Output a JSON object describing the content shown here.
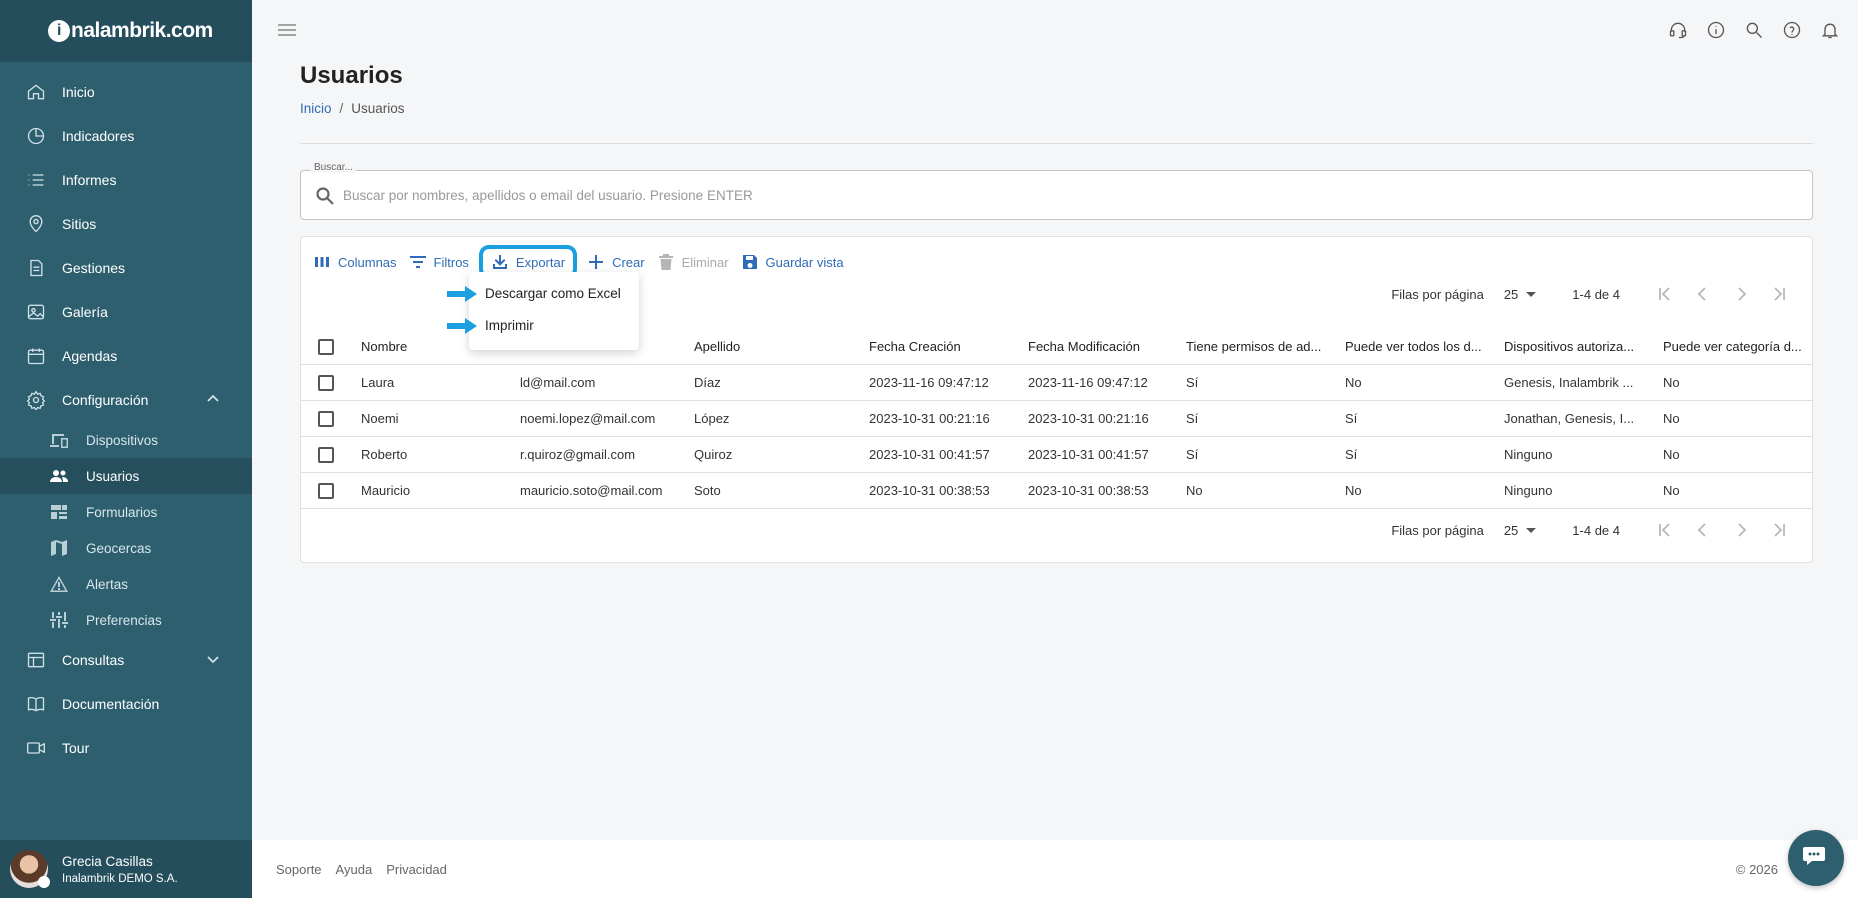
{
  "brand": {
    "logo_letter": "i",
    "logo_text": "nalambrik.com"
  },
  "sidebar": {
    "items": [
      {
        "label": "Inicio",
        "icon": "home-icon"
      },
      {
        "label": "Indicadores",
        "icon": "pie-chart-icon"
      },
      {
        "label": "Informes",
        "icon": "list-icon"
      },
      {
        "label": "Sitios",
        "icon": "location-pin-icon"
      },
      {
        "label": "Gestiones",
        "icon": "document-icon"
      },
      {
        "label": "Galería",
        "icon": "image-icon"
      },
      {
        "label": "Agendas",
        "icon": "calendar-icon"
      },
      {
        "label": "Configuración",
        "icon": "gear-icon",
        "expanded": true
      }
    ],
    "config_sub": [
      {
        "label": "Dispositivos",
        "icon": "devices-icon"
      },
      {
        "label": "Usuarios",
        "icon": "users-icon",
        "active": true
      },
      {
        "label": "Formularios",
        "icon": "forms-icon"
      },
      {
        "label": "Geocercas",
        "icon": "map-icon"
      },
      {
        "label": "Alertas",
        "icon": "warning-icon"
      },
      {
        "label": "Preferencias",
        "icon": "sliders-icon"
      }
    ],
    "bottom_items": [
      {
        "label": "Consultas",
        "icon": "table-icon"
      },
      {
        "label": "Documentación",
        "icon": "book-icon"
      },
      {
        "label": "Tour",
        "icon": "video-icon"
      }
    ]
  },
  "user": {
    "name": "Grecia Casillas",
    "company": "Inalambrik DEMO S.A."
  },
  "page": {
    "title": "Usuarios"
  },
  "breadcrumb": {
    "home": "Inicio",
    "current": "Usuarios",
    "separator": "/"
  },
  "search": {
    "label": "Buscar...",
    "placeholder": "Buscar por nombres, apellidos o email del usuario. Presione ENTER",
    "value": ""
  },
  "toolbar": {
    "columns": "Columnas",
    "filters": "Filtros",
    "export": "Exportar",
    "create": "Crear",
    "delete": "Eliminar",
    "save_view": "Guardar vista"
  },
  "export_menu": {
    "excel": "Descargar como Excel",
    "print": "Imprimir"
  },
  "pagination": {
    "rows_label": "Filas por página",
    "rows_value": "25",
    "range": "1-4 de 4"
  },
  "table": {
    "headers": [
      "Nombre",
      "Apellido",
      "Fecha Creación",
      "Fecha Modificación",
      "Tiene permisos de ad...",
      "Puede ver todos los d...",
      "Dispositivos autoriza...",
      "Puede ver categoría d..."
    ],
    "rows": [
      {
        "nombre": "Laura",
        "email": "ld@mail.com",
        "apellido": "Díaz",
        "creacion": "2023-11-16 09:47:12",
        "modificacion": "2023-11-16 09:47:12",
        "admin": "Sí",
        "ver_todos": "No",
        "dispositivos": "Genesis, Inalambrik ...",
        "categoria": "No"
      },
      {
        "nombre": "Noemi",
        "email": "noemi.lopez@mail.com",
        "apellido": "López",
        "creacion": "2023-10-31 00:21:16",
        "modificacion": "2023-10-31 00:21:16",
        "admin": "Sí",
        "ver_todos": "Sí",
        "dispositivos": "Jonathan, Genesis, I...",
        "categoria": "No"
      },
      {
        "nombre": "Roberto",
        "email": "r.quiroz@gmail.com",
        "apellido": "Quiroz",
        "creacion": "2023-10-31 00:41:57",
        "modificacion": "2023-10-31 00:41:57",
        "admin": "Sí",
        "ver_todos": "Sí",
        "dispositivos": "Ninguno",
        "categoria": "No"
      },
      {
        "nombre": "Mauricio",
        "email": "mauricio.soto@mail.com",
        "apellido": "Soto",
        "creacion": "2023-10-31 00:38:53",
        "modificacion": "2023-10-31 00:38:53",
        "admin": "No",
        "ver_todos": "No",
        "dispositivos": "Ninguno",
        "categoria": "No"
      }
    ]
  },
  "footer": {
    "links": [
      "Soporte",
      "Ayuda",
      "Privacidad"
    ],
    "copyright": "© 2026"
  },
  "colors": {
    "sidebar": "#2e5f6f",
    "accent": "#2f6cb5",
    "highlight": "#1aa0e0"
  }
}
